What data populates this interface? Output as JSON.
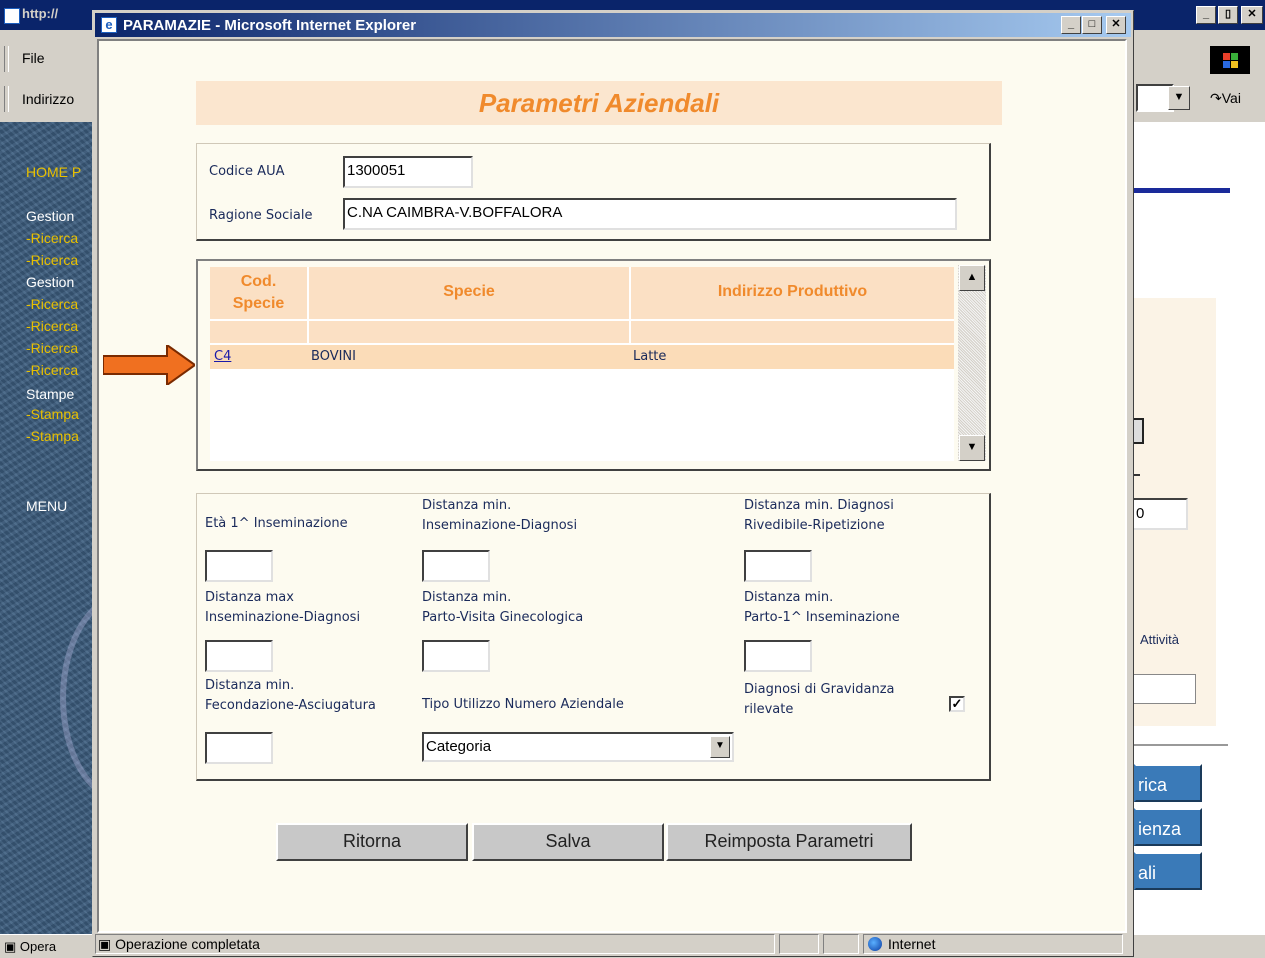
{
  "background_window": {
    "title": "http://",
    "menu_file": "File",
    "address_label": "Indirizzo",
    "go_label": "Vai",
    "sidebar": [
      "HOME P",
      "Gestion",
      "-Ricerca",
      "-Ricerca",
      "Gestion",
      "-Ricerca",
      "-Ricerca",
      "-Ricerca",
      "-Ricerca",
      "Stampe",
      "-Stampa",
      "-Stampa",
      "MENU"
    ],
    "right_fragments": {
      "input_value": "0",
      "attivita_label": "Attività",
      "btn1": "rica",
      "btn2": "ienza",
      "btn3": "ali"
    },
    "status_text": "Opera"
  },
  "popup": {
    "title": "PARAMAZIE - Microsoft Internet Explorer",
    "status_text": "Operazione completata",
    "zone_text": "Internet"
  },
  "form": {
    "heading": "Parametri Aziendali",
    "codice_aua_label": "Codice AUA",
    "codice_aua_value": "1300051",
    "ragione_sociale_label": "Ragione Sociale",
    "ragione_sociale_value": "C.NA CAIMBRA-V.BOFFALORA",
    "table": {
      "headers": [
        "Cod. Specie",
        "Specie",
        "Indirizzo Produttivo"
      ],
      "rows": [
        {
          "cod": "C4",
          "specie": "BOVINI",
          "indirizzo": "Latte"
        }
      ]
    },
    "fields": {
      "eta_label": "Età 1^ Inseminazione",
      "dist_min_ins_diag_label_1": "Distanza min.",
      "dist_min_ins_diag_label_2": "Inseminazione-Diagnosi",
      "dist_min_diag_riv_label_1": "Distanza min. Diagnosi",
      "dist_min_diag_riv_label_2": "Rivedibile-Ripetizione",
      "dist_max_label_1": "Distanza max",
      "dist_max_label_2": "Inseminazione-Diagnosi",
      "dist_min_parto_visita_label_1": "Distanza min.",
      "dist_min_parto_visita_label_2": "Parto-Visita Ginecologica",
      "dist_min_parto_ins_label_1": "Distanza min.",
      "dist_min_parto_ins_label_2": "Parto-1^ Inseminazione",
      "dist_min_fec_label_1": "Distanza min.",
      "dist_min_fec_label_2": "Fecondazione-Asciugatura",
      "tipo_utilizzo_label": "Tipo Utilizzo Numero Aziendale",
      "tipo_utilizzo_value": "Categoria",
      "diagnosi_label_1": "Diagnosi di Gravidanza",
      "diagnosi_label_2": "rilevate",
      "diagnosi_checked": true
    },
    "buttons": {
      "ritorna": "Ritorna",
      "salva": "Salva",
      "reimposta": "Reimposta Parametri"
    }
  },
  "colors": {
    "accent": "#f08a2c",
    "header_band": "#fbe6cf",
    "table_header": "#fbe0c4",
    "row_highlight": "#fbdcb8",
    "label_text": "#1a2a5a",
    "title_bar": "#0a246a"
  },
  "icons": {
    "ie": "ie-icon",
    "arrow": "arrow-right-icon",
    "dropdown": "chevron-down-icon",
    "globe": "globe-icon"
  }
}
